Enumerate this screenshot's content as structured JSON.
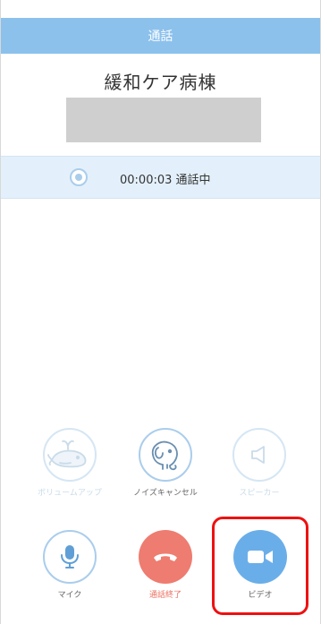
{
  "header": {
    "title": "通話"
  },
  "contact": {
    "name": "緩和ケア病棟"
  },
  "status": {
    "timer": "00:00:03",
    "state": "通話中"
  },
  "controls": {
    "volume_up": {
      "label": "ボリュームアップ",
      "icon": "whale-icon",
      "enabled": false
    },
    "noise_cancel": {
      "label": "ノイズキャンセル",
      "icon": "elephant-icon",
      "enabled": true
    },
    "speaker": {
      "label": "スピーカー",
      "icon": "speaker-icon",
      "enabled": false
    },
    "mic": {
      "label": "マイク",
      "icon": "microphone-icon"
    },
    "end_call": {
      "label": "通話終了",
      "icon": "phone-hangup-icon"
    },
    "video": {
      "label": "ビデオ",
      "icon": "video-camera-icon"
    }
  },
  "colors": {
    "header": "#8cc1ec",
    "status_bg": "#e3f0fb",
    "outline": "#aacdec",
    "hangup": "#ee7c70",
    "video": "#6aaee9",
    "highlight": "#ee1111"
  }
}
